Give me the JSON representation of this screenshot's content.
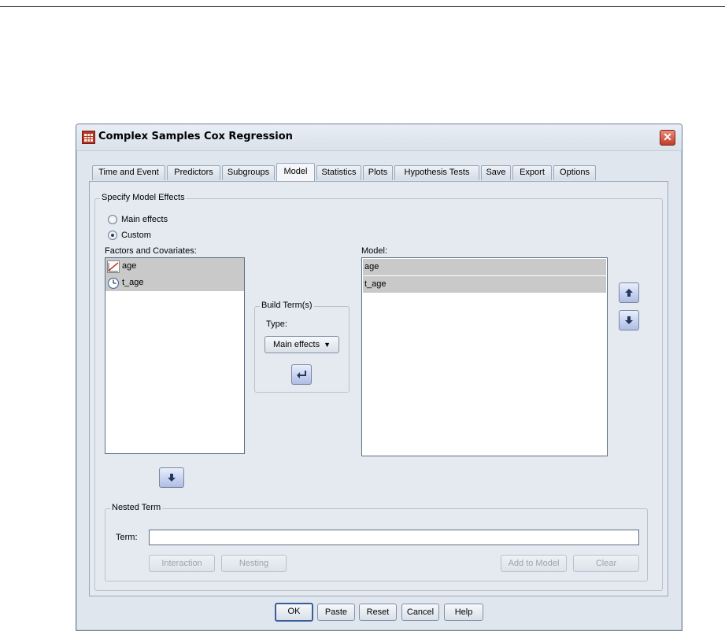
{
  "window": {
    "title": "Complex Samples Cox Regression",
    "close_glyph": "✕"
  },
  "tabs": [
    {
      "label": "Time and Event",
      "active": false
    },
    {
      "label": "Predictors",
      "active": false
    },
    {
      "label": "Subgroups",
      "active": false
    },
    {
      "label": "Model",
      "active": true
    },
    {
      "label": "Statistics",
      "active": false
    },
    {
      "label": "Plots",
      "active": false
    },
    {
      "label": "Hypothesis Tests",
      "active": false
    },
    {
      "label": "Save",
      "active": false
    },
    {
      "label": "Export",
      "active": false
    },
    {
      "label": "Options",
      "active": false
    }
  ],
  "specify": {
    "title": "Specify Model Effects",
    "main_effects_label": "Main effects",
    "custom_label": "Custom",
    "selected": "custom"
  },
  "factors": {
    "label": "Factors and Covariates:",
    "items": [
      {
        "name": "age",
        "icon": "scale-variable-icon"
      },
      {
        "name": "t_age",
        "icon": "time-variable-icon"
      }
    ]
  },
  "build_term": {
    "title": "Build Term(s)",
    "type_label": "Type:",
    "type_value": "Main effects",
    "dropdown_glyph": "▼"
  },
  "model": {
    "label": "Model:",
    "items": [
      "age",
      "t_age"
    ]
  },
  "nested": {
    "title": "Nested Term",
    "term_label": "Term:",
    "term_value": "",
    "interaction_label": "Interaction",
    "nesting_label": "Nesting",
    "add_label": "Add to Model",
    "clear_label": "Clear"
  },
  "footer": {
    "ok": "OK",
    "paste": "Paste",
    "reset": "Reset",
    "cancel": "Cancel",
    "help": "Help"
  },
  "colors": {
    "accent": "#3a5e9b",
    "selection": "#c9c9c9",
    "close": "#c43b28"
  }
}
